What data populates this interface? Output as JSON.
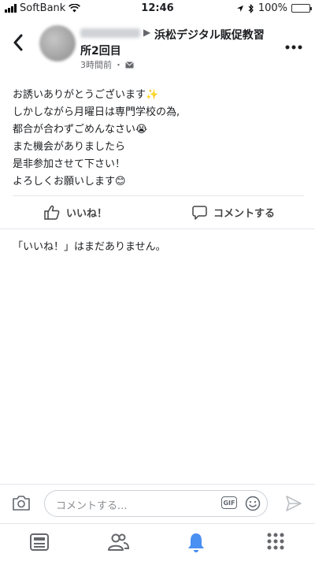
{
  "status_bar": {
    "carrier": "SoftBank",
    "time": "12:46",
    "battery": "100%"
  },
  "post": {
    "group_arrow": "▶",
    "group_name_line1": "浜松デジタル販促教習",
    "group_name_line2": "所2回目",
    "timestamp": "3時間前",
    "separator": "・",
    "body_lines": [
      "お誘いありがとうございます✨",
      "しかしながら月曜日は専門学校の為,",
      "都合が合わずごめんなさい😭",
      "また機会がありましたら",
      "是非参加させて下さい！",
      "よろしくお願いします😊"
    ]
  },
  "actions": {
    "like_label": "いいね！",
    "comment_label": "コメントする"
  },
  "likes_status": "「いいね！」はまだありません。",
  "comment_input": {
    "placeholder": "コメントする...",
    "gif_label": "GIF"
  },
  "icons": {
    "back": "chevron-left-icon",
    "more": "more-dots-icon",
    "camera": "camera-icon",
    "emoji": "smiley-icon",
    "send": "send-icon",
    "tabs": [
      "news-feed-icon",
      "groups-icon",
      "notifications-bell-icon",
      "menu-grid-icon"
    ]
  },
  "colors": {
    "active_tab": "#4a8ff2",
    "inactive_icon": "#65676b",
    "battery": "#4cd964"
  }
}
